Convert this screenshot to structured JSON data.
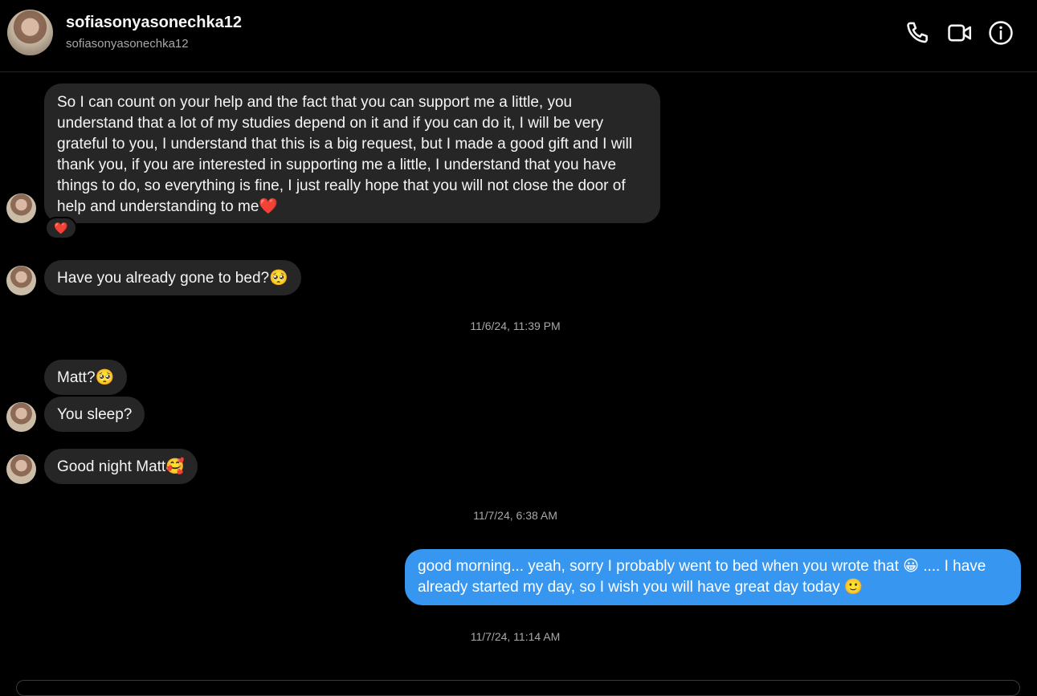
{
  "header": {
    "display_name": "sofiasonyasonechka12",
    "username": "sofiasonyasonechka12",
    "icons": [
      "phone-icon",
      "video-camera-icon",
      "info-icon"
    ]
  },
  "messages": [
    {
      "text": "So I can count on your help and the fact that you can support me a little, you understand that a lot of my studies depend on it and if you can do it, I will be very grateful to you, I understand that this is a big request, but I made a good gift and I will thank you, if you are interested in supporting me a little, I understand that you have things to do, so everything is fine, I just really hope that you will not close the door of help and understanding to me❤️",
      "reaction": "❤️"
    },
    {
      "text": "Have you already gone to bed?🥺"
    },
    {
      "timestamp": "11/6/24, 11:39 PM"
    },
    {
      "text": "Matt?🥺"
    },
    {
      "text": "You sleep?"
    },
    {
      "text": "Good night Matt🥰"
    },
    {
      "timestamp": "11/7/24, 6:38 AM"
    },
    {
      "text": "good morning... yeah, sorry I probably went to bed when you wrote that 😀 .... I have already started my day, so I wish you will have great day today 🙂"
    },
    {
      "timestamp": "11/7/24, 11:14 AM"
    }
  ],
  "colors": {
    "background": "#000000",
    "incoming_bubble": "#262626",
    "outgoing_bubble": "#3797f0",
    "muted_text": "#a8a8a8"
  }
}
